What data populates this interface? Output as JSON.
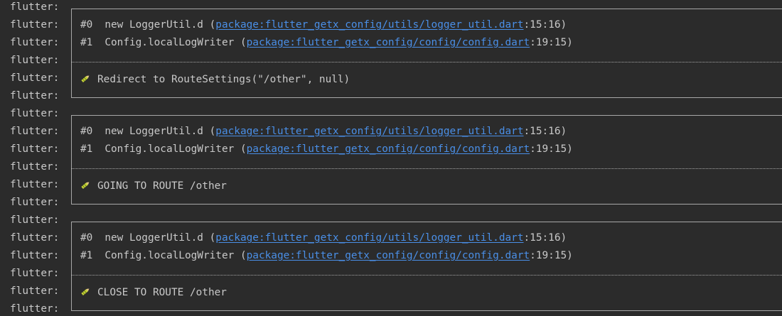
{
  "console": {
    "prefix": "flutter:",
    "blocks": [
      {
        "frames": [
          {
            "index": "#0",
            "method": "new LoggerUtil.d",
            "open": "(",
            "link": "package:flutter_getx_config/utils/logger_util.dart",
            "pos": ":15:16)"
          },
          {
            "index": "#1",
            "method": "Config.localLogWriter",
            "open": "(",
            "link": "package:flutter_getx_config/config/config.dart",
            "pos": ":19:15)"
          }
        ],
        "message": "Redirect to RouteSettings(\"/other\", null)"
      },
      {
        "frames": [
          {
            "index": "#0",
            "method": "new LoggerUtil.d",
            "open": "(",
            "link": "package:flutter_getx_config/utils/logger_util.dart",
            "pos": ":15:16)"
          },
          {
            "index": "#1",
            "method": "Config.localLogWriter",
            "open": "(",
            "link": "package:flutter_getx_config/config/config.dart",
            "pos": ":19:15)"
          }
        ],
        "message": "GOING TO ROUTE /other"
      },
      {
        "frames": [
          {
            "index": "#0",
            "method": "new LoggerUtil.d",
            "open": "(",
            "link": "package:flutter_getx_config/utils/logger_util.dart",
            "pos": ":15:16)"
          },
          {
            "index": "#1",
            "method": "Config.localLogWriter",
            "open": "(",
            "link": "package:flutter_getx_config/config/config.dart",
            "pos": ":19:15)"
          }
        ],
        "message": "CLOSE TO ROUTE /other"
      }
    ],
    "message_icon": "crayon-icon",
    "colors": {
      "background": "#2b2b2b",
      "text": "#c9c9c9",
      "link": "#4a8fe7",
      "border": "#a8a8a8"
    }
  }
}
